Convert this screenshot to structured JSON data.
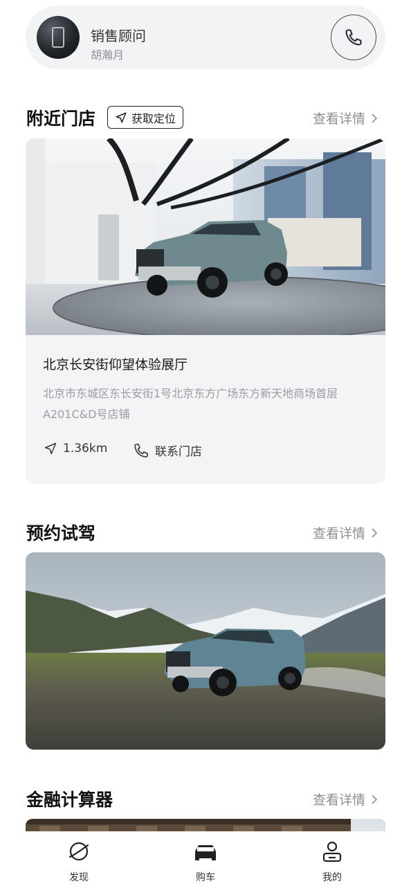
{
  "advisor": {
    "title": "销售顾问",
    "name": "胡瀚月"
  },
  "nearby": {
    "title": "附近门店",
    "locate_label": "获取定位",
    "more_label": "查看详情",
    "store": {
      "name": "北京长安街仰望体验展厅",
      "address": "北京市东城区东长安街1号北京东方广场东方新天地商场首层A201C&D号店铺",
      "distance": "1.36km",
      "contact_label": "联系门店"
    }
  },
  "test_drive": {
    "title": "预约试驾",
    "more_label": "查看详情"
  },
  "finance": {
    "title": "金融计算器",
    "more_label": "查看详情"
  },
  "tabs": [
    {
      "label": "发现",
      "icon": "planet-icon"
    },
    {
      "label": "购车",
      "icon": "car-icon"
    },
    {
      "label": "我的",
      "icon": "user-icon"
    }
  ]
}
